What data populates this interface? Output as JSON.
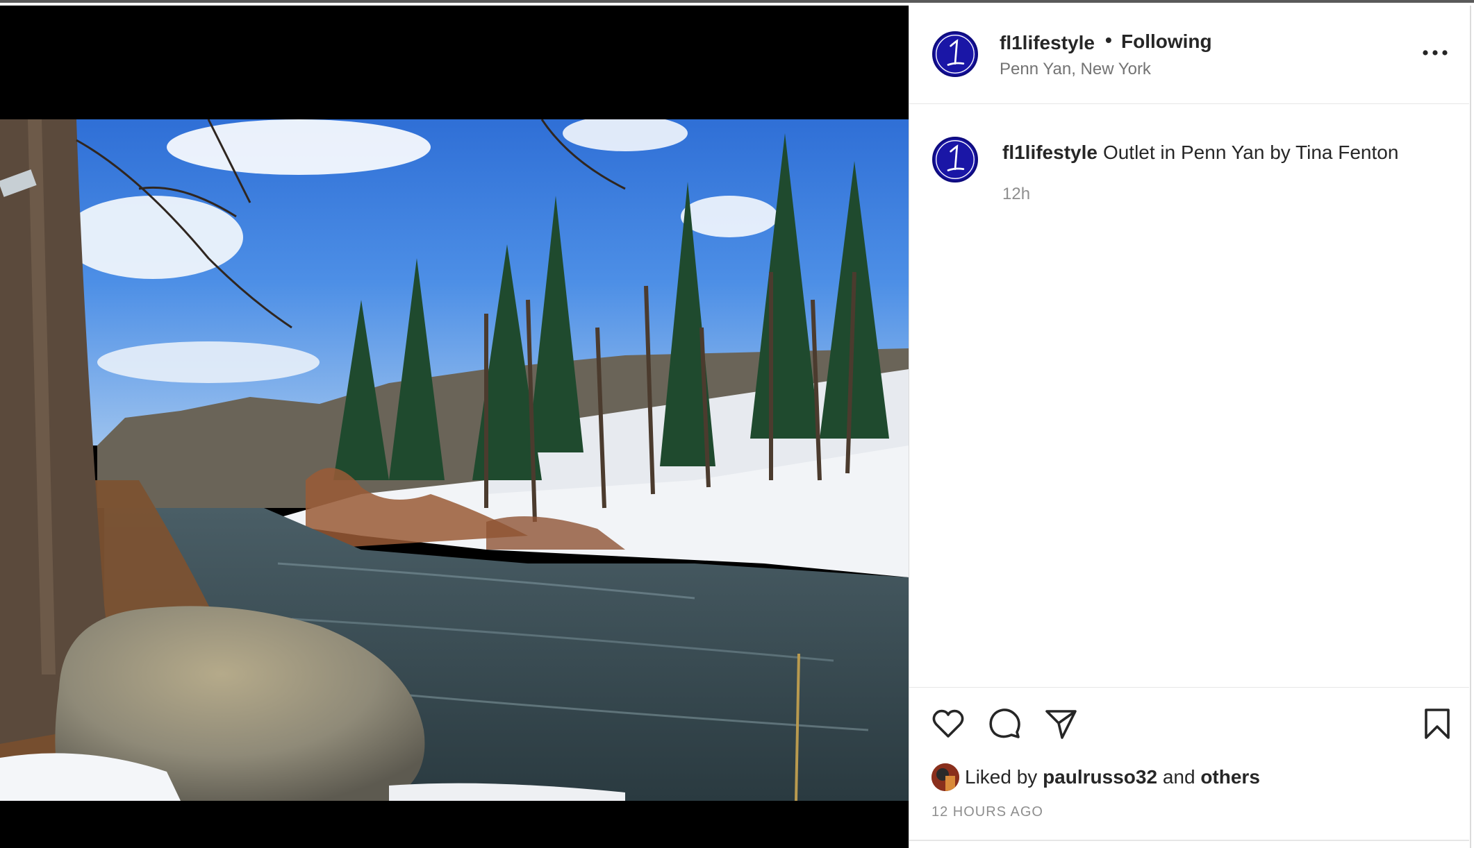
{
  "post": {
    "username": "fl1lifestyle",
    "separator": "•",
    "follow_status": "Following",
    "location": "Penn Yan, New York"
  },
  "caption": {
    "username": "fl1lifestyle",
    "text": "Outlet in Penn Yan by Tina Fenton",
    "time_ago": "12h"
  },
  "likes": {
    "prefix": "Liked by",
    "liker": "paulrusso32",
    "conjunction": "and",
    "others": "others"
  },
  "timestamp": "12 HOURS AGO",
  "icons": {
    "like": "heart-icon",
    "comment": "comment-bubble-icon",
    "share": "paper-plane-icon",
    "save": "bookmark-icon",
    "more": "ellipsis-icon"
  },
  "colors": {
    "avatar_bg": "#1a16a6",
    "text_primary": "#262626",
    "text_secondary": "#737373"
  }
}
